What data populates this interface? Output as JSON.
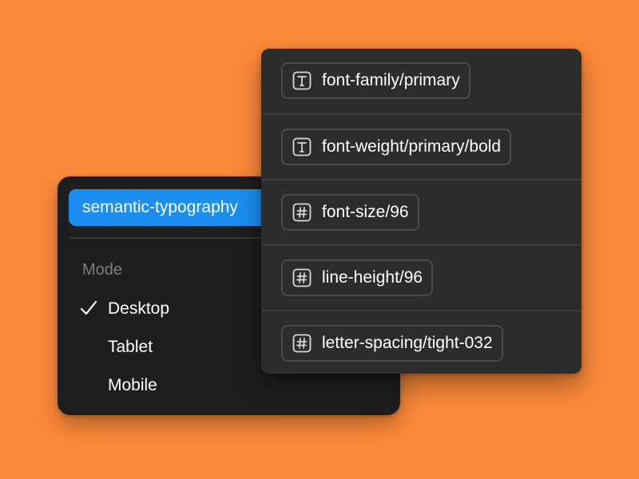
{
  "colors": {
    "background": "#fd8a3a",
    "accent": "#1b8ef0",
    "panel_dark": "#1e1e1e",
    "panel_variables": "#2c2c2c"
  },
  "collection": {
    "name": "semantic-typography"
  },
  "mode_menu": {
    "heading": "Mode",
    "items": [
      {
        "label": "Desktop",
        "selected": true,
        "icon": "check-icon"
      },
      {
        "label": "Tablet",
        "selected": false
      },
      {
        "label": "Mobile",
        "selected": false
      }
    ]
  },
  "variables": [
    {
      "name": "font-family/primary",
      "icon": "text-type-icon"
    },
    {
      "name": "font-weight/primary/bold",
      "icon": "text-type-icon"
    },
    {
      "name": "font-size/96",
      "icon": "number-type-icon"
    },
    {
      "name": "line-height/96",
      "icon": "number-type-icon"
    },
    {
      "name": "letter-spacing/tight-032",
      "icon": "number-type-icon"
    }
  ]
}
